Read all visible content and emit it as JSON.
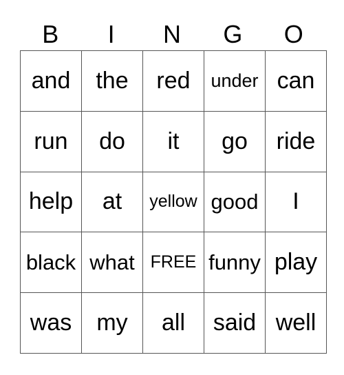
{
  "header": {
    "letters": [
      "B",
      "I",
      "N",
      "G",
      "O"
    ]
  },
  "grid": {
    "rows": [
      [
        "and",
        "the",
        "red",
        "under",
        "can"
      ],
      [
        "run",
        "do",
        "it",
        "go",
        "ride"
      ],
      [
        "help",
        "at",
        "yellow",
        "good",
        "I"
      ],
      [
        "black",
        "what",
        "FREE",
        "funny",
        "play"
      ],
      [
        "was",
        "my",
        "all",
        "said",
        "well"
      ]
    ],
    "free_space": "FREE"
  }
}
